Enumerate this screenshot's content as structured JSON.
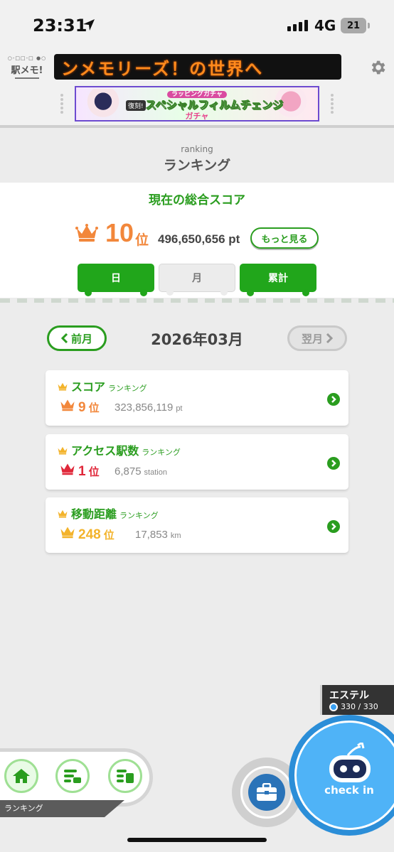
{
  "status_bar": {
    "time": "23:31",
    "network": "4G",
    "battery": "21"
  },
  "header": {
    "logo_top": "○-□□-□ ●○",
    "logo_text": "駅メモ!",
    "marquee": "ンメモリーズ！の世界へ",
    "banner": {
      "subtitle": "ラッピングガチャ",
      "tag": "復刻!",
      "title": "スペシャルフィルムチェンジ",
      "title2": "ガチャ"
    }
  },
  "page": {
    "title_en": "ranking",
    "title": "ランキング"
  },
  "total": {
    "heading": "現在の総合スコア",
    "rank": "10",
    "rank_unit": "位",
    "points": "496,650,656 pt",
    "more_label": "もっと見る"
  },
  "period_tabs": [
    {
      "label": "日",
      "active": true
    },
    {
      "label": "月",
      "active": false
    },
    {
      "label": "累計",
      "active": true
    }
  ],
  "month_nav": {
    "prev_label": "前月",
    "current": "2026年03月",
    "next_label": "翌月"
  },
  "cards": [
    {
      "title": "スコア",
      "suffix": "ランキング",
      "rank": "9",
      "rank_unit": "位",
      "value": "323,856,119",
      "unit": "pt",
      "rank_color": "#f2873b"
    },
    {
      "title": "アクセス駅数",
      "suffix": "ランキング",
      "rank": "1",
      "rank_unit": "位",
      "value": "6,875",
      "unit": "station",
      "rank_color": "#e0283a"
    },
    {
      "title": "移動距離",
      "suffix": "ランキング",
      "rank": "248",
      "rank_unit": "位",
      "value": "17,853",
      "unit": "km",
      "rank_color": "#f3b32b"
    }
  ],
  "character": {
    "name": "エステル",
    "hp": "330 / 330"
  },
  "checkin": {
    "label": "check in"
  },
  "bottom_nav": {
    "label": "ランキング"
  },
  "icons": {
    "location": "location-arrow-icon",
    "settings": "gear-icon",
    "crown": "crown-icon",
    "chevron": "chevron-right-icon",
    "home": "home-icon",
    "bag": "briefcase-icon"
  },
  "colors": {
    "accent": "#2a9d1f",
    "orange": "#f2873b",
    "blue": "#4fb3f7"
  }
}
